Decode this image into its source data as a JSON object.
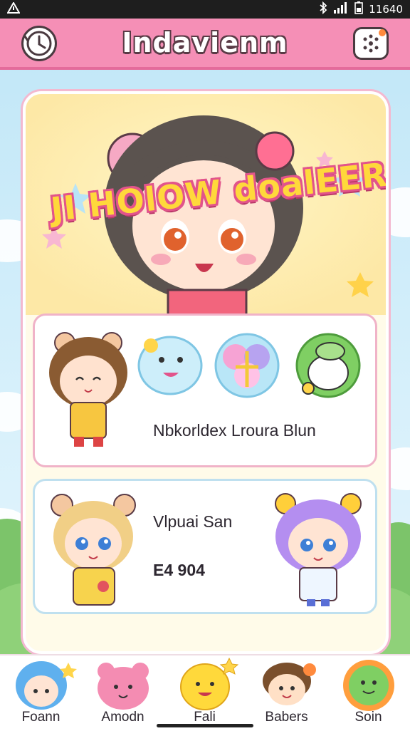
{
  "status_bar": {
    "time": "11640"
  },
  "app_bar": {
    "title": "Indavienm"
  },
  "banner": {
    "title": "JI HOlOW doalEER"
  },
  "panel1": {
    "caption": "Nbkorldex Lroura Blun"
  },
  "panel2": {
    "name": "Vlpuai San",
    "code": "E4 904"
  },
  "nav": {
    "items": [
      {
        "label": "Foann"
      },
      {
        "label": "Amodn"
      },
      {
        "label": "Fali"
      },
      {
        "label": "Babers"
      },
      {
        "label": "Soin"
      }
    ]
  },
  "colors": {
    "accent": "#f58fb6",
    "banner_text": "#ffd83b",
    "banner_outline": "#e2548b"
  }
}
